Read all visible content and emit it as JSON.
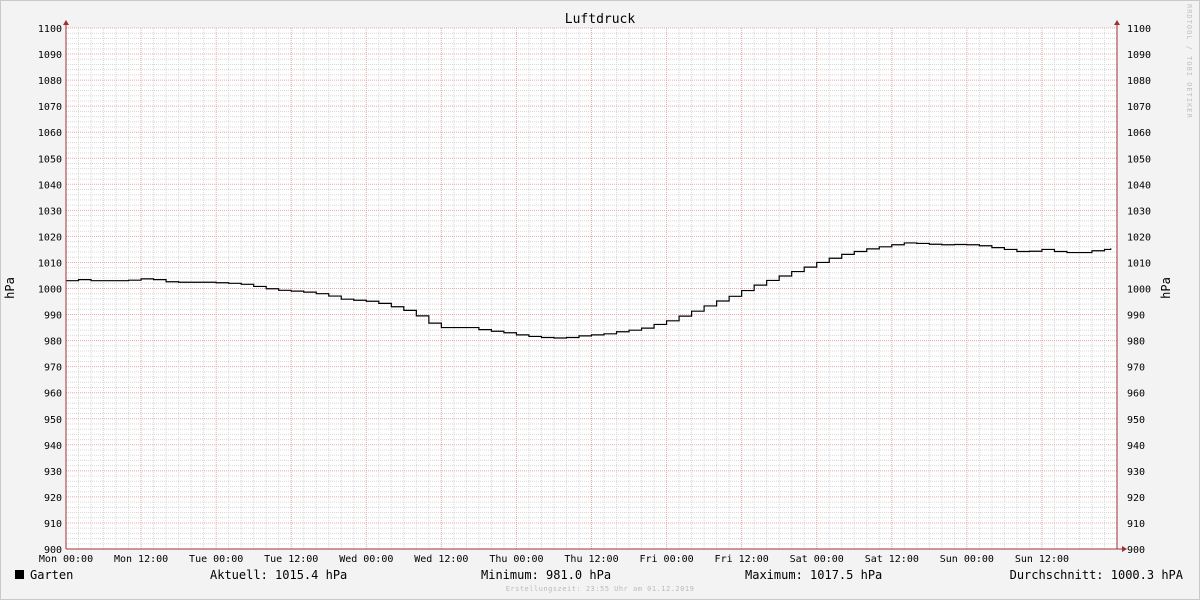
{
  "chart_data": {
    "type": "line",
    "title": "Luftdruck",
    "ylabel": "hPa",
    "ylabel_right": "hPa",
    "ylim": [
      900,
      1100
    ],
    "y_ticks": [
      900,
      910,
      920,
      930,
      940,
      950,
      960,
      970,
      980,
      990,
      1000,
      1010,
      1020,
      1030,
      1040,
      1050,
      1060,
      1070,
      1080,
      1090,
      1100
    ],
    "x_tick_labels": [
      "Mon 00:00",
      "Mon 12:00",
      "Tue 00:00",
      "Tue 12:00",
      "Wed 00:00",
      "Wed 12:00",
      "Thu 00:00",
      "Thu 12:00",
      "Fri 00:00",
      "Fri 12:00",
      "Sat 00:00",
      "Sat 12:00",
      "Sun 00:00",
      "Sun 12:00"
    ],
    "x_unit": "hours since Mon 00:00",
    "x_range": [
      0,
      168
    ],
    "grid": true,
    "series": [
      {
        "name": "Garten",
        "color": "#000000",
        "x": [
          0,
          2,
          4,
          6,
          8,
          10,
          12,
          14,
          16,
          18,
          20,
          22,
          24,
          26,
          28,
          30,
          32,
          34,
          36,
          38,
          40,
          42,
          44,
          46,
          48,
          50,
          52,
          54,
          56,
          58,
          60,
          62,
          64,
          66,
          68,
          70,
          72,
          74,
          76,
          78,
          80,
          82,
          84,
          86,
          88,
          90,
          92,
          94,
          96,
          98,
          100,
          102,
          104,
          106,
          108,
          110,
          112,
          114,
          116,
          118,
          120,
          122,
          124,
          126,
          128,
          130,
          132,
          134,
          136,
          138,
          140,
          142,
          144,
          146,
          148,
          150,
          152,
          154,
          156,
          158,
          160,
          162,
          164,
          166,
          167
        ],
        "values": [
          1003.0,
          1003.4,
          1003.0,
          1003.0,
          1003.0,
          1003.2,
          1003.7,
          1003.4,
          1002.6,
          1002.4,
          1002.4,
          1002.4,
          1002.2,
          1002.0,
          1001.6,
          1000.8,
          999.9,
          999.3,
          999.0,
          998.6,
          998.0,
          997.1,
          995.9,
          995.5,
          995.1,
          994.3,
          993.0,
          991.6,
          989.5,
          986.7,
          985.0,
          985.0,
          985.0,
          984.2,
          983.6,
          983.0,
          982.2,
          981.6,
          981.2,
          981.0,
          981.2,
          981.8,
          982.2,
          982.6,
          983.4,
          984.0,
          984.8,
          986.2,
          987.6,
          989.4,
          991.3,
          993.3,
          995.2,
          997.0,
          999.2,
          1001.3,
          1003.1,
          1004.8,
          1006.5,
          1008.2,
          1010.0,
          1011.6,
          1013.1,
          1014.2,
          1015.2,
          1016.0,
          1016.8,
          1017.5,
          1017.3,
          1017.0,
          1016.8,
          1016.9,
          1016.8,
          1016.4,
          1015.7,
          1015.0,
          1014.2,
          1014.3,
          1015.0,
          1014.2,
          1013.8,
          1013.8,
          1014.5,
          1015.0,
          1015.4
        ]
      }
    ],
    "legend": {
      "series_name": "Garten",
      "current": "Aktuell: 1015.4 hPa",
      "minimum": "Minimum: 981.0 hPa",
      "maximum": "Maximum: 1017.5 hPa",
      "average": "Durchschnitt: 1000.3 hPA"
    },
    "footer": "Erstellungszeit: 23:55 Uhr am 01.12.2019",
    "watermark": "RRDTOOL / TOBI OETIKER",
    "colors": {
      "background": "#f3f3f3",
      "plot_background": "#ffffff",
      "major_grid": "#e8a8a8",
      "minor_grid": "#d8d8d8",
      "axis": "#a03030",
      "line": "#000000"
    }
  }
}
